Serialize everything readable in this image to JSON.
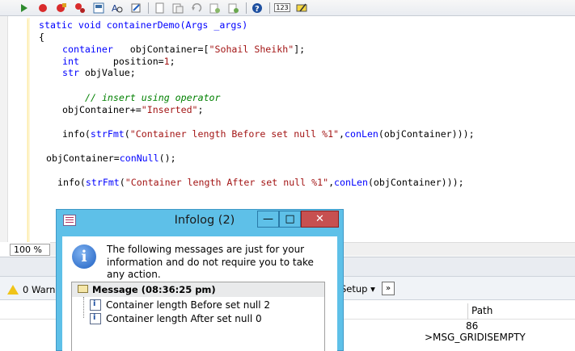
{
  "toolbar": {
    "icons": [
      "run-icon",
      "stop-icon",
      "stop-debug-icon",
      "breakpoint-icon",
      "debug-icon",
      "find-icon",
      "edit-icon",
      "copy-icon",
      "paste-icon",
      "undo-icon",
      "redo-icon",
      "compile-icon",
      "help-icon",
      "label-icon",
      "lookup-icon"
    ],
    "label_123": "123"
  },
  "code": {
    "line1": "static void containerDemo(Args _args)",
    "line2": "{",
    "line3a": "container",
    "line3b": "   objContainer=[",
    "line3c": "\"Sohail Sheikh\"",
    "line3d": "];",
    "line4a": "int",
    "line4b": "      position=",
    "line4c": "1",
    "line4d": ";",
    "line5a": "str",
    "line5b": " objValue;",
    "line6": "// insert using operator",
    "line7a": "objContainer+=",
    "line7b": "\"Inserted\"",
    "line7c": ";",
    "line8a": "info(",
    "line8b": "strFmt",
    "line8c": "(",
    "line8d": "\"Container length Before set null %1\"",
    "line8e": ",",
    "line8f": "conLen",
    "line8g": "(objContainer)));",
    "line9a": "objContainer=",
    "line9b": "conNull",
    "line9c": "();",
    "line10a": "info(",
    "line10b": "strFmt",
    "line10c": "(",
    "line10d": "\"Container length After set null %1\"",
    "line10e": ",",
    "line10f": "conLen",
    "line10g": "(objContainer)));"
  },
  "zoom": "100 %",
  "panel": {
    "warnings_label": "0 Warni",
    "setup_label": "Setup ▾",
    "more_label": "»",
    "path_header": "Path",
    "cell1": "86",
    "cell2": ">MSG_GRIDISEMPTY"
  },
  "dialog": {
    "title": "Infolog (2)",
    "min": "—",
    "max": "□",
    "close": "✕",
    "info_text": "The following messages are just for your information and do not require you to take any action.",
    "message_header": "Message (08:36:25 pm)",
    "messages": [
      "Container length Before set null 2",
      "Container length After set null 0"
    ]
  },
  "colors": {
    "keyword": "#0000ff",
    "string": "#a31515",
    "comment": "#008000",
    "titlebar": "#5ec0e8",
    "close_button": "#c75050"
  }
}
